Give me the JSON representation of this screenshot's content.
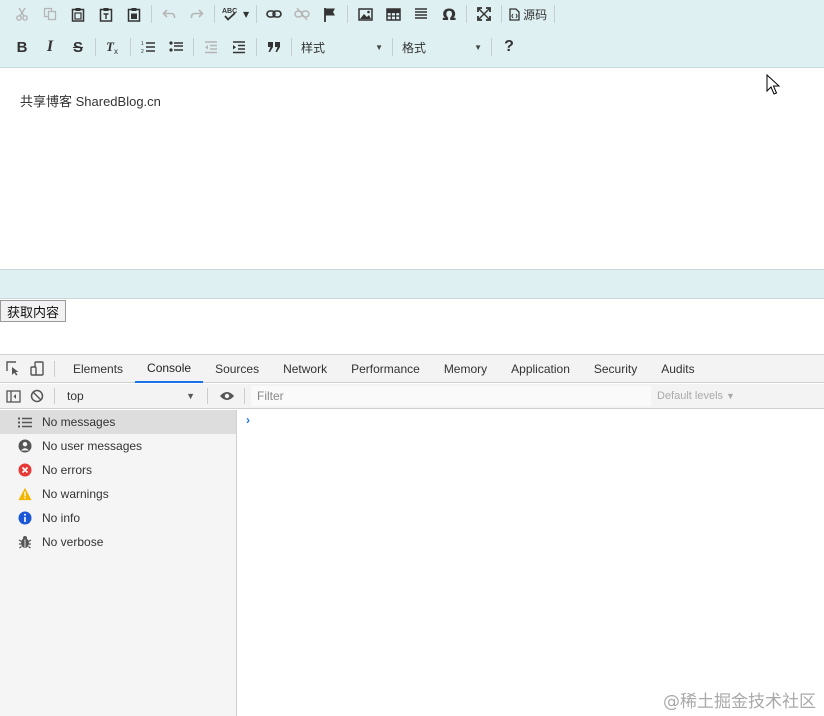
{
  "editor": {
    "toolbar_row1": {
      "cut_icon": "scissors-icon",
      "source_label": "源码"
    },
    "toolbar_row2": {
      "bold": "B",
      "italic": "I",
      "strike": "S",
      "style_combo": "样式",
      "format_combo": "格式",
      "help": "?"
    },
    "content_text": "共享博客 SharedBlog.cn"
  },
  "get_content_button": "获取内容",
  "devtools": {
    "tabs": [
      "Elements",
      "Console",
      "Sources",
      "Network",
      "Performance",
      "Memory",
      "Application",
      "Security",
      "Audits"
    ],
    "active_tab": "Console",
    "context": "top",
    "filter_placeholder": "Filter",
    "levels_label": "Default levels",
    "sidebar": [
      {
        "label": "No messages",
        "icon": "list-icon"
      },
      {
        "label": "No user messages",
        "icon": "user-icon"
      },
      {
        "label": "No errors",
        "icon": "error-icon"
      },
      {
        "label": "No warnings",
        "icon": "warning-icon"
      },
      {
        "label": "No info",
        "icon": "info-icon"
      },
      {
        "label": "No verbose",
        "icon": "bug-icon"
      }
    ],
    "prompt": "›"
  },
  "watermark": "@稀土掘金技术社区",
  "colors": {
    "editor_chrome": "#dff0f2",
    "accent": "#1a73e8",
    "error": "#e53935",
    "warning": "#f2b600",
    "info": "#1a57d6"
  }
}
